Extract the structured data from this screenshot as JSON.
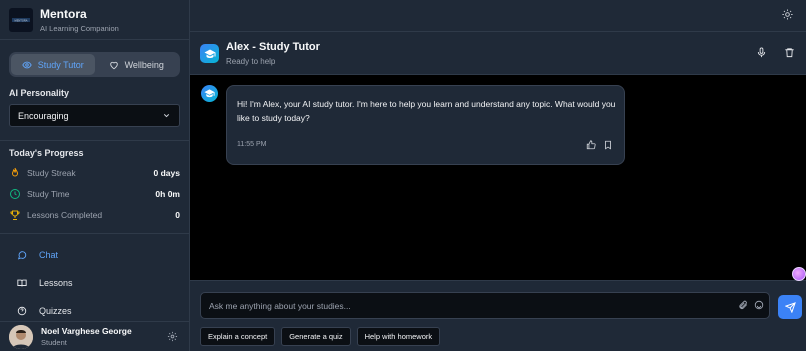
{
  "app": {
    "name": "Mentora",
    "tagline": "AI Learning Companion",
    "logo_text": "MENTORA"
  },
  "modes": [
    {
      "label": "Study Tutor",
      "active": true,
      "icon": "eye-icon"
    },
    {
      "label": "Wellbeing",
      "active": false,
      "icon": "heart-icon"
    }
  ],
  "personality": {
    "label": "AI Personality",
    "selected": "Encouraging"
  },
  "progress": {
    "title": "Today's Progress",
    "stats": [
      {
        "label": "Study Streak",
        "value": "0 days",
        "icon": "flame-icon",
        "color": "#f59e0b"
      },
      {
        "label": "Study Time",
        "value": "0h 0m",
        "icon": "clock-icon",
        "color": "#10b981"
      },
      {
        "label": "Lessons Completed",
        "value": "0",
        "icon": "trophy-icon",
        "color": "#eab308"
      }
    ]
  },
  "nav": [
    {
      "label": "Chat",
      "active": true,
      "icon": "chat-bubble-icon"
    },
    {
      "label": "Lessons",
      "active": false,
      "icon": "book-icon"
    },
    {
      "label": "Quizzes",
      "active": false,
      "icon": "help-circle-icon"
    }
  ],
  "user": {
    "name": "Noel Varghese George",
    "role": "Student"
  },
  "chat": {
    "title": "Alex - Study Tutor",
    "status": "Ready to help"
  },
  "messages": [
    {
      "sender": "bot",
      "text": "Hi! I'm Alex, your AI study tutor. I'm here to help you learn and understand any topic. What would you like to study today?",
      "time": "11:55 PM"
    }
  ],
  "composer": {
    "placeholder": "Ask me anything about your studies...",
    "suggestions": [
      "Explain a concept",
      "Generate a quiz",
      "Help with homework"
    ]
  },
  "colors": {
    "accent": "#3b82f6",
    "sidebar_bg": "#1f2937",
    "main_bg": "#000000"
  }
}
